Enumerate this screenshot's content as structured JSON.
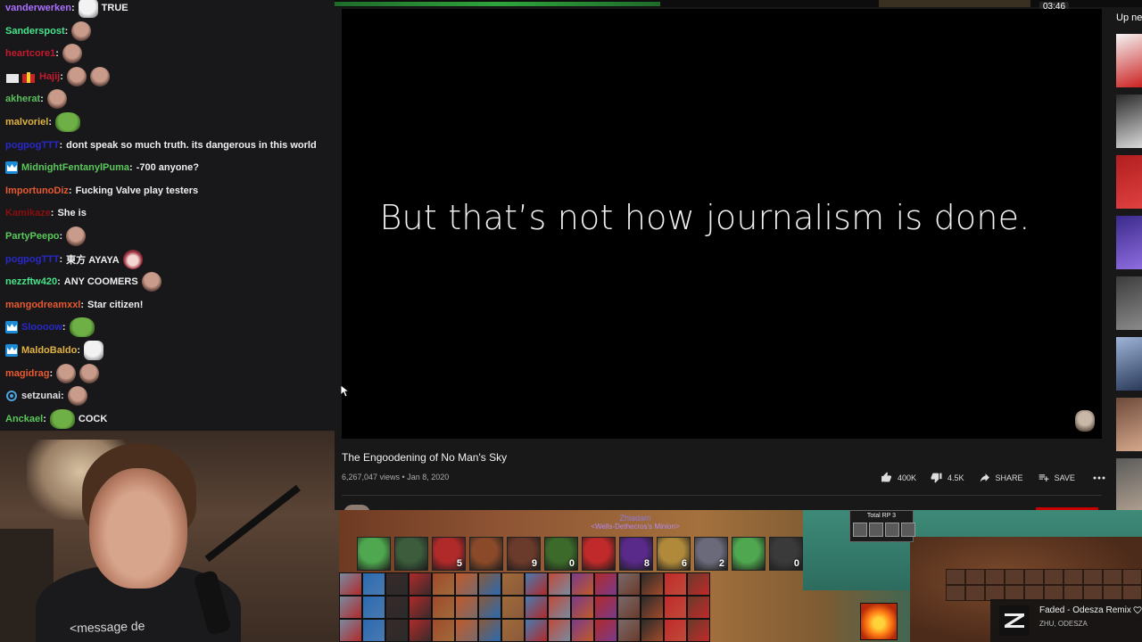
{
  "chat": {
    "messages": [
      {
        "user": "vanderwerken",
        "color": "#a970ff",
        "emotes": [
          "white"
        ],
        "text": "TRUE",
        "badge": ""
      },
      {
        "user": "Sanderspost",
        "color": "#46e58a",
        "emotes": [
          "face"
        ],
        "text": "",
        "badge": ""
      },
      {
        "user": "heartcore1",
        "color": "#c41a2c",
        "emotes": [
          "face"
        ],
        "text": "",
        "badge": ""
      },
      {
        "user": "Hajij",
        "color": "#c41a2c",
        "emotes": [
          "face",
          "face"
        ],
        "text": "",
        "badge": "gift"
      },
      {
        "user": "akherat",
        "color": "#5bbf5b",
        "emotes": [
          "face"
        ],
        "text": "",
        "badge": ""
      },
      {
        "user": "malvoriel",
        "color": "#e0b340",
        "emotes": [
          "pepe"
        ],
        "text": "",
        "badge": ""
      },
      {
        "user": "pogpogTTT",
        "color": "#2828c8",
        "emotes": [],
        "text": "dont speak so much truth. its dangerous in this world",
        "badge": ""
      },
      {
        "user": "MidnightFentanylPuma",
        "color": "#5ac85a",
        "emotes": [],
        "text": "-700 anyone?",
        "badge": "crown"
      },
      {
        "user": "ImportunoDiz",
        "color": "#e8592f",
        "emotes": [],
        "text": "Fucking Valve play testers",
        "badge": ""
      },
      {
        "user": "Kamikaze",
        "color": "#8c0e0e",
        "emotes": [],
        "text": "She is",
        "badge": ""
      },
      {
        "user": "PartyPeepo",
        "color": "#5ac85a",
        "emotes": [
          "face"
        ],
        "text": "",
        "badge": ""
      },
      {
        "user": "pogpogTTT",
        "color": "#2828c8",
        "emotes": [],
        "text": "東方 AYAYA",
        "badge": "",
        "trail": [
          "girl"
        ]
      },
      {
        "user": "nezzftw420",
        "color": "#46e58a",
        "emotes": [],
        "text": "ANY COOMERS",
        "badge": "",
        "trail": [
          "face"
        ]
      },
      {
        "user": "mangodreamxxl",
        "color": "#e8592f",
        "emotes": [],
        "text": "Star citizen!",
        "badge": ""
      },
      {
        "user": "Sloooow",
        "color": "#2828c8",
        "emotes": [
          "pepe"
        ],
        "text": "",
        "badge": "crown"
      },
      {
        "user": "MaldoBaldo",
        "color": "#e0b340",
        "emotes": [
          "white"
        ],
        "text": "",
        "badge": "crown"
      },
      {
        "user": "magidrag",
        "color": "#e8592f",
        "emotes": [
          "face",
          "face"
        ],
        "text": "",
        "badge": ""
      },
      {
        "user": "setzunai",
        "color": "#e0e0e0",
        "emotes": [
          "face"
        ],
        "text": "",
        "badge": "ring"
      },
      {
        "user": "Anckael",
        "color": "#5ac85a",
        "emotes": [
          "pepe"
        ],
        "text": "COCK",
        "badge": ""
      }
    ]
  },
  "webcam": {
    "overlay_text": "<message de"
  },
  "video": {
    "caption": "But that’s not how journalism is done.",
    "time": "03:46",
    "title": "The Engoodening of No Man's Sky",
    "meta": "6,267,047 views • Jan 8, 2020",
    "likes": "400K",
    "dislikes": "4.5K",
    "share_label": "SHARE",
    "save_label": "SAVE",
    "up_next_label": "Up ne"
  },
  "recommendations": [
    {
      "colors": [
        "#f4f4f4",
        "#c22"
      ]
    },
    {
      "colors": [
        "#2a2a2a",
        "#d9d9d9"
      ]
    },
    {
      "colors": [
        "#b11e1e",
        "#e04040"
      ]
    },
    {
      "colors": [
        "#3a2a8a",
        "#8f6de0"
      ]
    },
    {
      "colors": [
        "#3c3c3c",
        "#8a8a8a"
      ]
    },
    {
      "colors": [
        "#9fb5d8",
        "#2a3a5a"
      ]
    },
    {
      "colors": [
        "#6d4a3a",
        "#d4a78a"
      ]
    },
    {
      "colors": [
        "#5a5a5a",
        "#b0a090"
      ]
    }
  ],
  "game": {
    "title": "Zhiadam",
    "subtitle": "<Wells-Dethecros's Minion>",
    "total_rp": "Total RP 3",
    "heroes": [
      {
        "color": "#4fa84f",
        "level": ""
      },
      {
        "color": "#3c5c3c",
        "level": ""
      },
      {
        "color": "#b02a2a",
        "level": "5"
      },
      {
        "color": "#8a4a2a",
        "level": ""
      },
      {
        "color": "#6a3a2a",
        "level": "9"
      },
      {
        "color": "#3c6a2a",
        "level": "0"
      },
      {
        "color": "#c02a2a",
        "level": ""
      },
      {
        "color": "#5a2a8a",
        "level": "8"
      },
      {
        "color": "#b08a3a",
        "level": "6"
      },
      {
        "color": "#6a6a7a",
        "level": "2"
      },
      {
        "color": "#4fa84f",
        "level": ""
      },
      {
        "color": "#3a3a3a",
        "level": "0"
      }
    ],
    "item_colors": [
      "#7a8aa0",
      "#2a6ab0",
      "#3a2a2a",
      "#b02a2a",
      "#a04a2a",
      "#c05a2a",
      "#8a5a3a",
      "#a06a3a",
      "#4a7ab0",
      "#c04a3a",
      "#7a3a8a",
      "#b02a2a",
      "#7a6a6a",
      "#2a2a2a",
      "#c02a2a",
      "#6a3a2a"
    ]
  },
  "now_playing": {
    "title": "Faded - Odesza Remix",
    "artist": "ZHU, ODESZA"
  }
}
